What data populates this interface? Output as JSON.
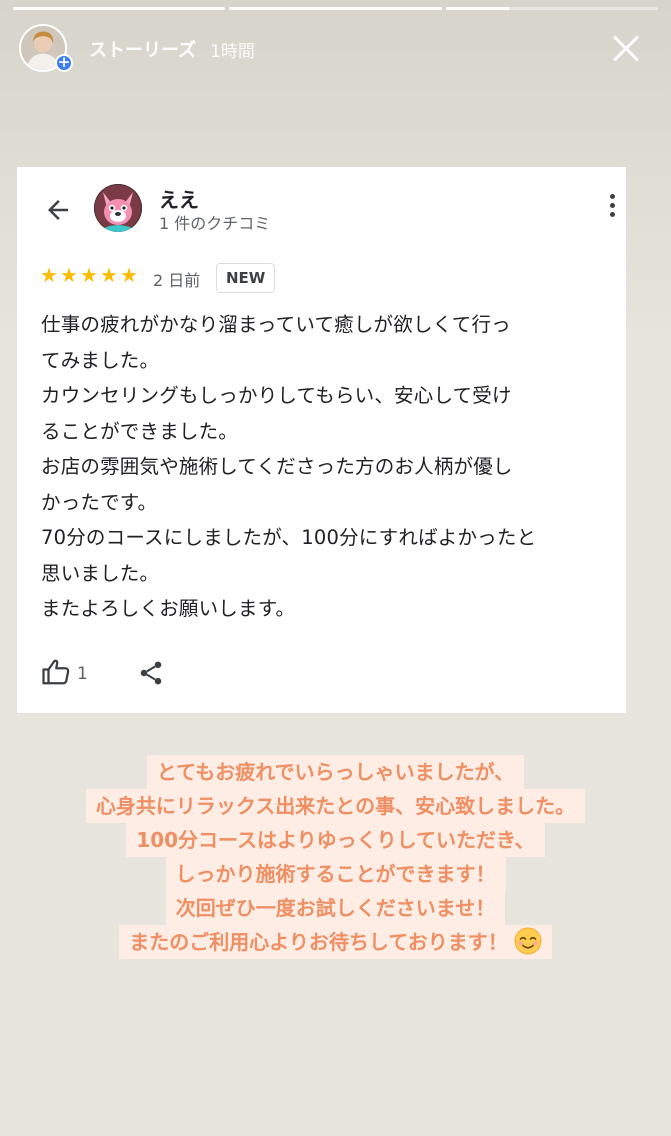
{
  "story": {
    "progress": [
      1.0,
      1.0,
      0.3
    ],
    "title": "ストーリーズ",
    "time": "1時間"
  },
  "review": {
    "reviewer_name": "ええ",
    "reviewer_count": "1 件のクチコミ",
    "rating": 5,
    "stars": [
      "★",
      "★",
      "★",
      "★",
      "★"
    ],
    "date": "2 日前",
    "badge": "NEW",
    "lines": [
      "仕事の疲れがかなり溜まっていて癒しが欲しくて行っ",
      "てみました。",
      "カウンセリングもしっかりしてもらい、安心して受け",
      "ることができました。",
      "お店の雰囲気や施術してくださった方のお人柄が優し",
      "かったです。",
      "70分のコースにしましたが、100分にすればよかったと",
      "思いました。",
      "またよろしくお願いします。"
    ],
    "like_count": "1"
  },
  "reply": {
    "lines": [
      "とてもお疲れでいらっしゃいましたが、",
      "心身共にリラックス出来たとの事、安心致しました。",
      "100分コースはよりゆっくりしていただき、",
      "しっかり施術することができます！",
      "次回ぜひ一度お試しくださいませ！",
      "またのご利用心よりお待ちしております！"
    ]
  },
  "icons": {
    "close": "close-icon",
    "back": "arrow-back-icon",
    "more": "more-vert-icon",
    "like": "thumb-up-icon",
    "share": "share-icon",
    "emoji": "smiling-face-icon"
  },
  "colors": {
    "star": "#fbbc04",
    "reply_text": "#ef8f63",
    "reply_bg": "#ffeee4",
    "add_badge": "#3a7ef2"
  }
}
